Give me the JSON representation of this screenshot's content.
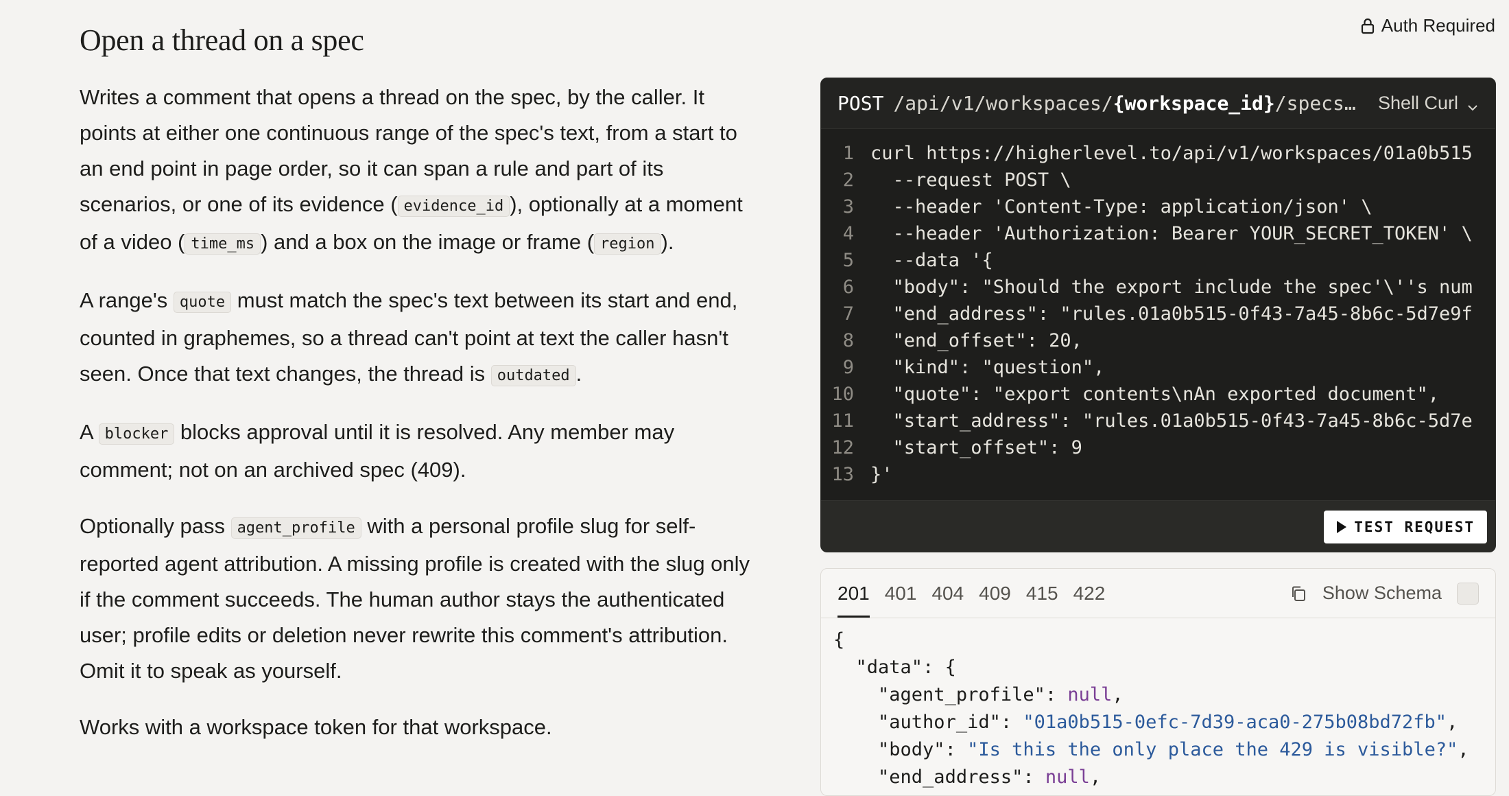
{
  "page": {
    "title": "Open a thread on a spec",
    "auth_badge": "Auth Required"
  },
  "description": [
    {
      "parts": [
        {
          "t": "text",
          "v": "Writes a comment that opens a thread on the spec, by the caller. It points at either one continuous range of the spec's text, from a start to an end point in page order, so it can span a rule and part of its scenarios, or one of its evidence ("
        },
        {
          "t": "code",
          "v": "evidence_id"
        },
        {
          "t": "text",
          "v": "), optionally at a moment of a video ("
        },
        {
          "t": "code",
          "v": "time_ms"
        },
        {
          "t": "text",
          "v": ") and a box on the image or frame ("
        },
        {
          "t": "code",
          "v": "region"
        },
        {
          "t": "text",
          "v": ")."
        }
      ]
    },
    {
      "parts": [
        {
          "t": "text",
          "v": "A range's "
        },
        {
          "t": "code",
          "v": "quote"
        },
        {
          "t": "text",
          "v": " must match the spec's text between its start and end, counted in graphemes, so a thread can't point at text the caller hasn't seen. Once that text changes, the thread is "
        },
        {
          "t": "code",
          "v": "outdated"
        },
        {
          "t": "text",
          "v": "."
        }
      ]
    },
    {
      "parts": [
        {
          "t": "text",
          "v": "A "
        },
        {
          "t": "code",
          "v": "blocker"
        },
        {
          "t": "text",
          "v": " blocks approval until it is resolved. Any member may comment; not on an archived spec (409)."
        }
      ]
    },
    {
      "parts": [
        {
          "t": "text",
          "v": "Optionally pass "
        },
        {
          "t": "code",
          "v": "agent_profile"
        },
        {
          "t": "text",
          "v": " with a personal profile slug for self-reported agent attribution. A missing profile is created with the slug only if the comment succeeds. The human author stays the authenticated user; profile edits or deletion never rewrite this comment's attribution. Omit it to speak as yourself."
        }
      ]
    },
    {
      "parts": [
        {
          "t": "text",
          "v": "Works with a workspace token for that workspace."
        }
      ]
    }
  ],
  "request": {
    "method": "POST",
    "path_prefix": "/api/v1/workspaces/",
    "path_param": "{workspace_id}",
    "path_suffix": "/specs...",
    "language": "Shell Curl",
    "test_button": "TEST REQUEST",
    "code_lines": [
      "curl https://higherlevel.to/api/v1/workspaces/01a0b515",
      "  --request POST \\",
      "  --header 'Content-Type: application/json' \\",
      "  --header 'Authorization: Bearer YOUR_SECRET_TOKEN' \\",
      "  --data '{",
      "  \"body\": \"Should the export include the spec'\\''s num",
      "  \"end_address\": \"rules.01a0b515-0f43-7a45-8b6c-5d7e9f",
      "  \"end_offset\": 20,",
      "  \"kind\": \"question\",",
      "  \"quote\": \"export contents\\nAn exported document\",",
      "  \"start_address\": \"rules.01a0b515-0f43-7a45-8b6c-5d7e",
      "  \"start_offset\": 9",
      "}'"
    ]
  },
  "response": {
    "status_tabs": [
      "201",
      "401",
      "404",
      "409",
      "415",
      "422"
    ],
    "active_tab": "201",
    "show_schema_label": "Show Schema",
    "json_lines": [
      [
        {
          "c": "p",
          "v": "{"
        }
      ],
      [
        {
          "c": "p",
          "v": "  "
        },
        {
          "c": "k",
          "v": "\"data\""
        },
        {
          "c": "p",
          "v": ": {"
        }
      ],
      [
        {
          "c": "p",
          "v": "    "
        },
        {
          "c": "k",
          "v": "\"agent_profile\""
        },
        {
          "c": "p",
          "v": ": "
        },
        {
          "c": "n",
          "v": "null"
        },
        {
          "c": "p",
          "v": ","
        }
      ],
      [
        {
          "c": "p",
          "v": "    "
        },
        {
          "c": "k",
          "v": "\"author_id\""
        },
        {
          "c": "p",
          "v": ": "
        },
        {
          "c": "s",
          "v": "\"01a0b515-0efc-7d39-aca0-275b08bd72fb\""
        },
        {
          "c": "p",
          "v": ","
        }
      ],
      [
        {
          "c": "p",
          "v": "    "
        },
        {
          "c": "k",
          "v": "\"body\""
        },
        {
          "c": "p",
          "v": ": "
        },
        {
          "c": "s",
          "v": "\"Is this the only place the 429 is visible?\""
        },
        {
          "c": "p",
          "v": ","
        }
      ],
      [
        {
          "c": "p",
          "v": "    "
        },
        {
          "c": "k",
          "v": "\"end_address\""
        },
        {
          "c": "p",
          "v": ": "
        },
        {
          "c": "n",
          "v": "null"
        },
        {
          "c": "p",
          "v": ","
        }
      ]
    ]
  }
}
